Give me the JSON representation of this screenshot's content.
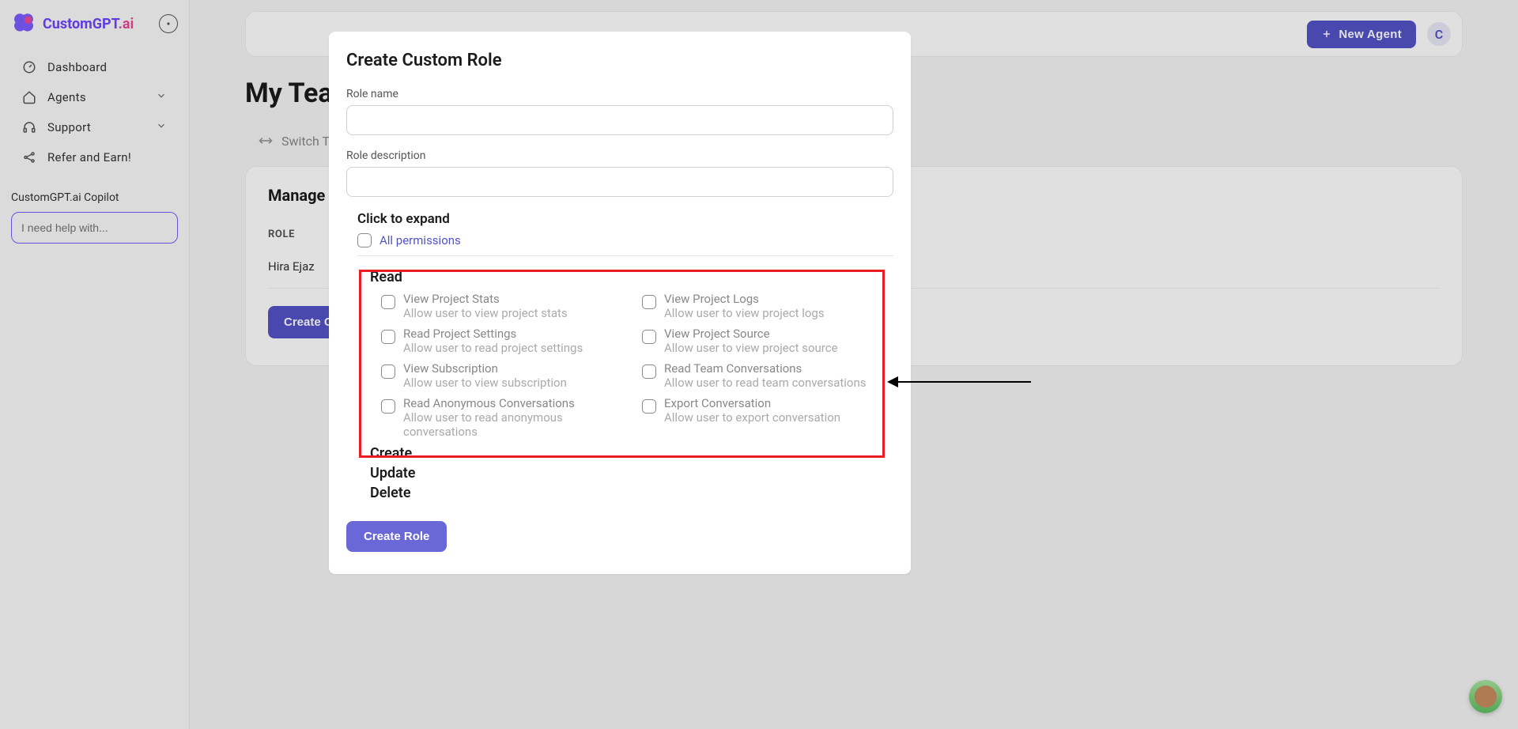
{
  "brand": {
    "name_part1": "CustomGPT",
    "name_part2": ".ai"
  },
  "sidebar": {
    "items": [
      {
        "label": "Dashboard"
      },
      {
        "label": "Agents"
      },
      {
        "label": "Support"
      },
      {
        "label": "Refer and Earn!"
      }
    ],
    "copilot_label": "CustomGPT.ai Copilot",
    "copilot_placeholder": "I need help with..."
  },
  "topbar": {
    "new_agent": "New Agent",
    "avatar_initial": "C"
  },
  "page": {
    "title": "My Team",
    "switch_label": "Switch Team",
    "panel_title": "Manage Roles",
    "table_header_role": "ROLE",
    "table_row_name": "Hira Ejaz",
    "create_custom_btn": "Create Custom Role"
  },
  "modal": {
    "title": "Create Custom Role",
    "role_name_label": "Role name",
    "role_desc_label": "Role description",
    "expand_label": "Click to expand",
    "all_permissions_link": "All permissions",
    "sections": {
      "read": "Read",
      "create": "Create",
      "update": "Update",
      "delete": "Delete"
    },
    "read_permissions": [
      {
        "title": "View Project Stats",
        "desc": "Allow user to view project stats"
      },
      {
        "title": "View Project Logs",
        "desc": "Allow user to view project logs"
      },
      {
        "title": "Read Project Settings",
        "desc": "Allow user to read project settings"
      },
      {
        "title": "View Project Source",
        "desc": "Allow user to view project source"
      },
      {
        "title": "View Subscription",
        "desc": "Allow user to view subscription"
      },
      {
        "title": "Read Team Conversations",
        "desc": "Allow user to read team conversations"
      },
      {
        "title": "Read Anonymous Conversations",
        "desc": "Allow user to read anonymous conversations"
      },
      {
        "title": "Export Conversation",
        "desc": "Allow user to export conversation"
      }
    ],
    "create_role_btn": "Create Role"
  }
}
